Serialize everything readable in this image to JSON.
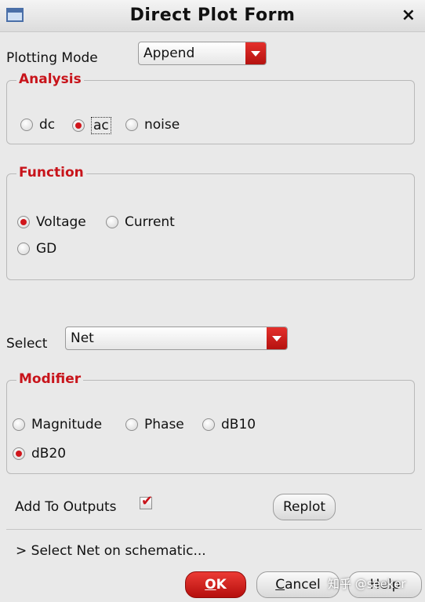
{
  "window": {
    "title": "Direct Plot Form",
    "close_glyph": "×"
  },
  "plotting_mode": {
    "label": "Plotting Mode",
    "value": "Append"
  },
  "analysis": {
    "legend": "Analysis",
    "options": [
      {
        "label": "dc",
        "selected": false
      },
      {
        "label": "ac",
        "selected": true
      },
      {
        "label": "noise",
        "selected": false
      }
    ]
  },
  "function": {
    "legend": "Function",
    "options": [
      {
        "label": "Voltage",
        "selected": true
      },
      {
        "label": "Current",
        "selected": false
      },
      {
        "label": "GD",
        "selected": false
      }
    ]
  },
  "select": {
    "label": "Select",
    "value": "Net"
  },
  "modifier": {
    "legend": "Modifier",
    "options": [
      {
        "label": "Magnitude",
        "selected": false
      },
      {
        "label": "Phase",
        "selected": false
      },
      {
        "label": "dB10",
        "selected": false
      },
      {
        "label": "dB20",
        "selected": true
      }
    ]
  },
  "add_to_outputs": {
    "label": "Add To Outputs",
    "checked": true
  },
  "buttons": {
    "replot": "Replot",
    "ok": {
      "mnemonic": "O",
      "rest": "K"
    },
    "cancel": {
      "mnemonic": "C",
      "rest": "ancel"
    },
    "help": "Help"
  },
  "status": "> Select Net on schematic...",
  "watermark": "知乎 @seeker",
  "colors": {
    "accent": "#c8141b",
    "background": "#e9e9e9"
  }
}
